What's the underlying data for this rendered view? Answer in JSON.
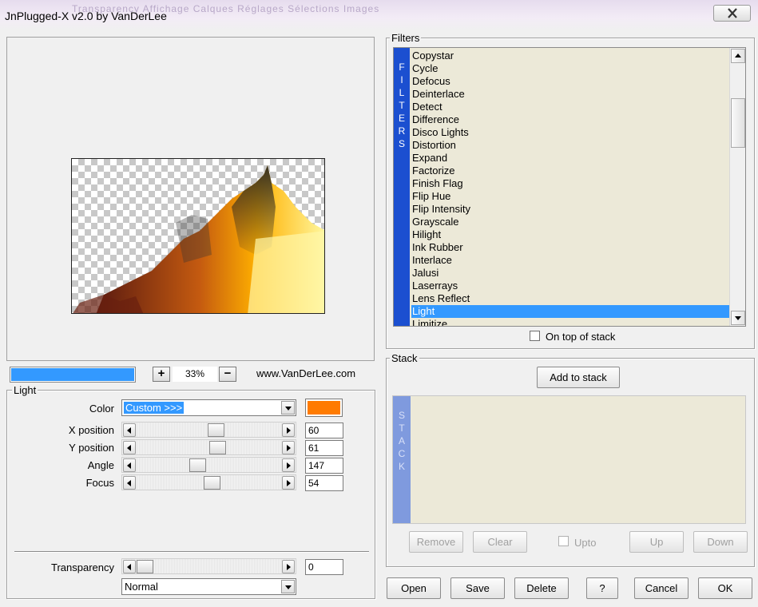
{
  "window": {
    "title": "JnPlugged-X v2.0 by VanDerLee",
    "background_ghost": "Transparency   Affichage   Calques   Réglages   Sélections   Images"
  },
  "preview": {
    "zoom": "33%",
    "zoom_in": "+",
    "zoom_out": "−",
    "website": "www.VanDerLee.com",
    "progress_fraction": 1.0
  },
  "light": {
    "group_label": "Light",
    "color_label": "Color",
    "color_combo": "Custom >>>",
    "color_swatch": "#ff7b00",
    "params": [
      {
        "label": "X position",
        "value": "60",
        "fraction": 0.55
      },
      {
        "label": "Y position",
        "value": "61",
        "fraction": 0.56
      },
      {
        "label": "Angle",
        "value": "147",
        "fraction": 0.41
      },
      {
        "label": "Focus",
        "value": "54",
        "fraction": 0.52
      }
    ],
    "transparency_label": "Transparency",
    "transparency_value": "0",
    "transparency_fraction": 0.0,
    "blend_mode": "Normal"
  },
  "filters": {
    "group_label": "Filters",
    "strip_letters": [
      "F",
      "I",
      "L",
      "T",
      "E",
      "R",
      "S"
    ],
    "items": [
      "Copystar",
      "Cycle",
      "Defocus",
      "Deinterlace",
      "Detect",
      "Difference",
      "Disco Lights",
      "Distortion",
      "Expand",
      "Factorize",
      "Finish Flag",
      "Flip Hue",
      "Flip Intensity",
      "Grayscale",
      "Hilight",
      "Ink Rubber",
      "Interlace",
      "Jalusi",
      "Laserrays",
      "Lens Reflect",
      "Light",
      "Limitize"
    ],
    "selected": "Light",
    "on_top_label": "On top of stack"
  },
  "stack": {
    "group_label": "Stack",
    "add_label": "Add to stack",
    "strip_letters": [
      "S",
      "T",
      "A",
      "C",
      "K"
    ],
    "remove_label": "Remove",
    "clear_label": "Clear",
    "upto_label": "Upto",
    "up_label": "Up",
    "down_label": "Down"
  },
  "footer": {
    "open": "Open",
    "save": "Save",
    "delete": "Delete",
    "help": "?",
    "cancel": "Cancel",
    "ok": "OK"
  }
}
